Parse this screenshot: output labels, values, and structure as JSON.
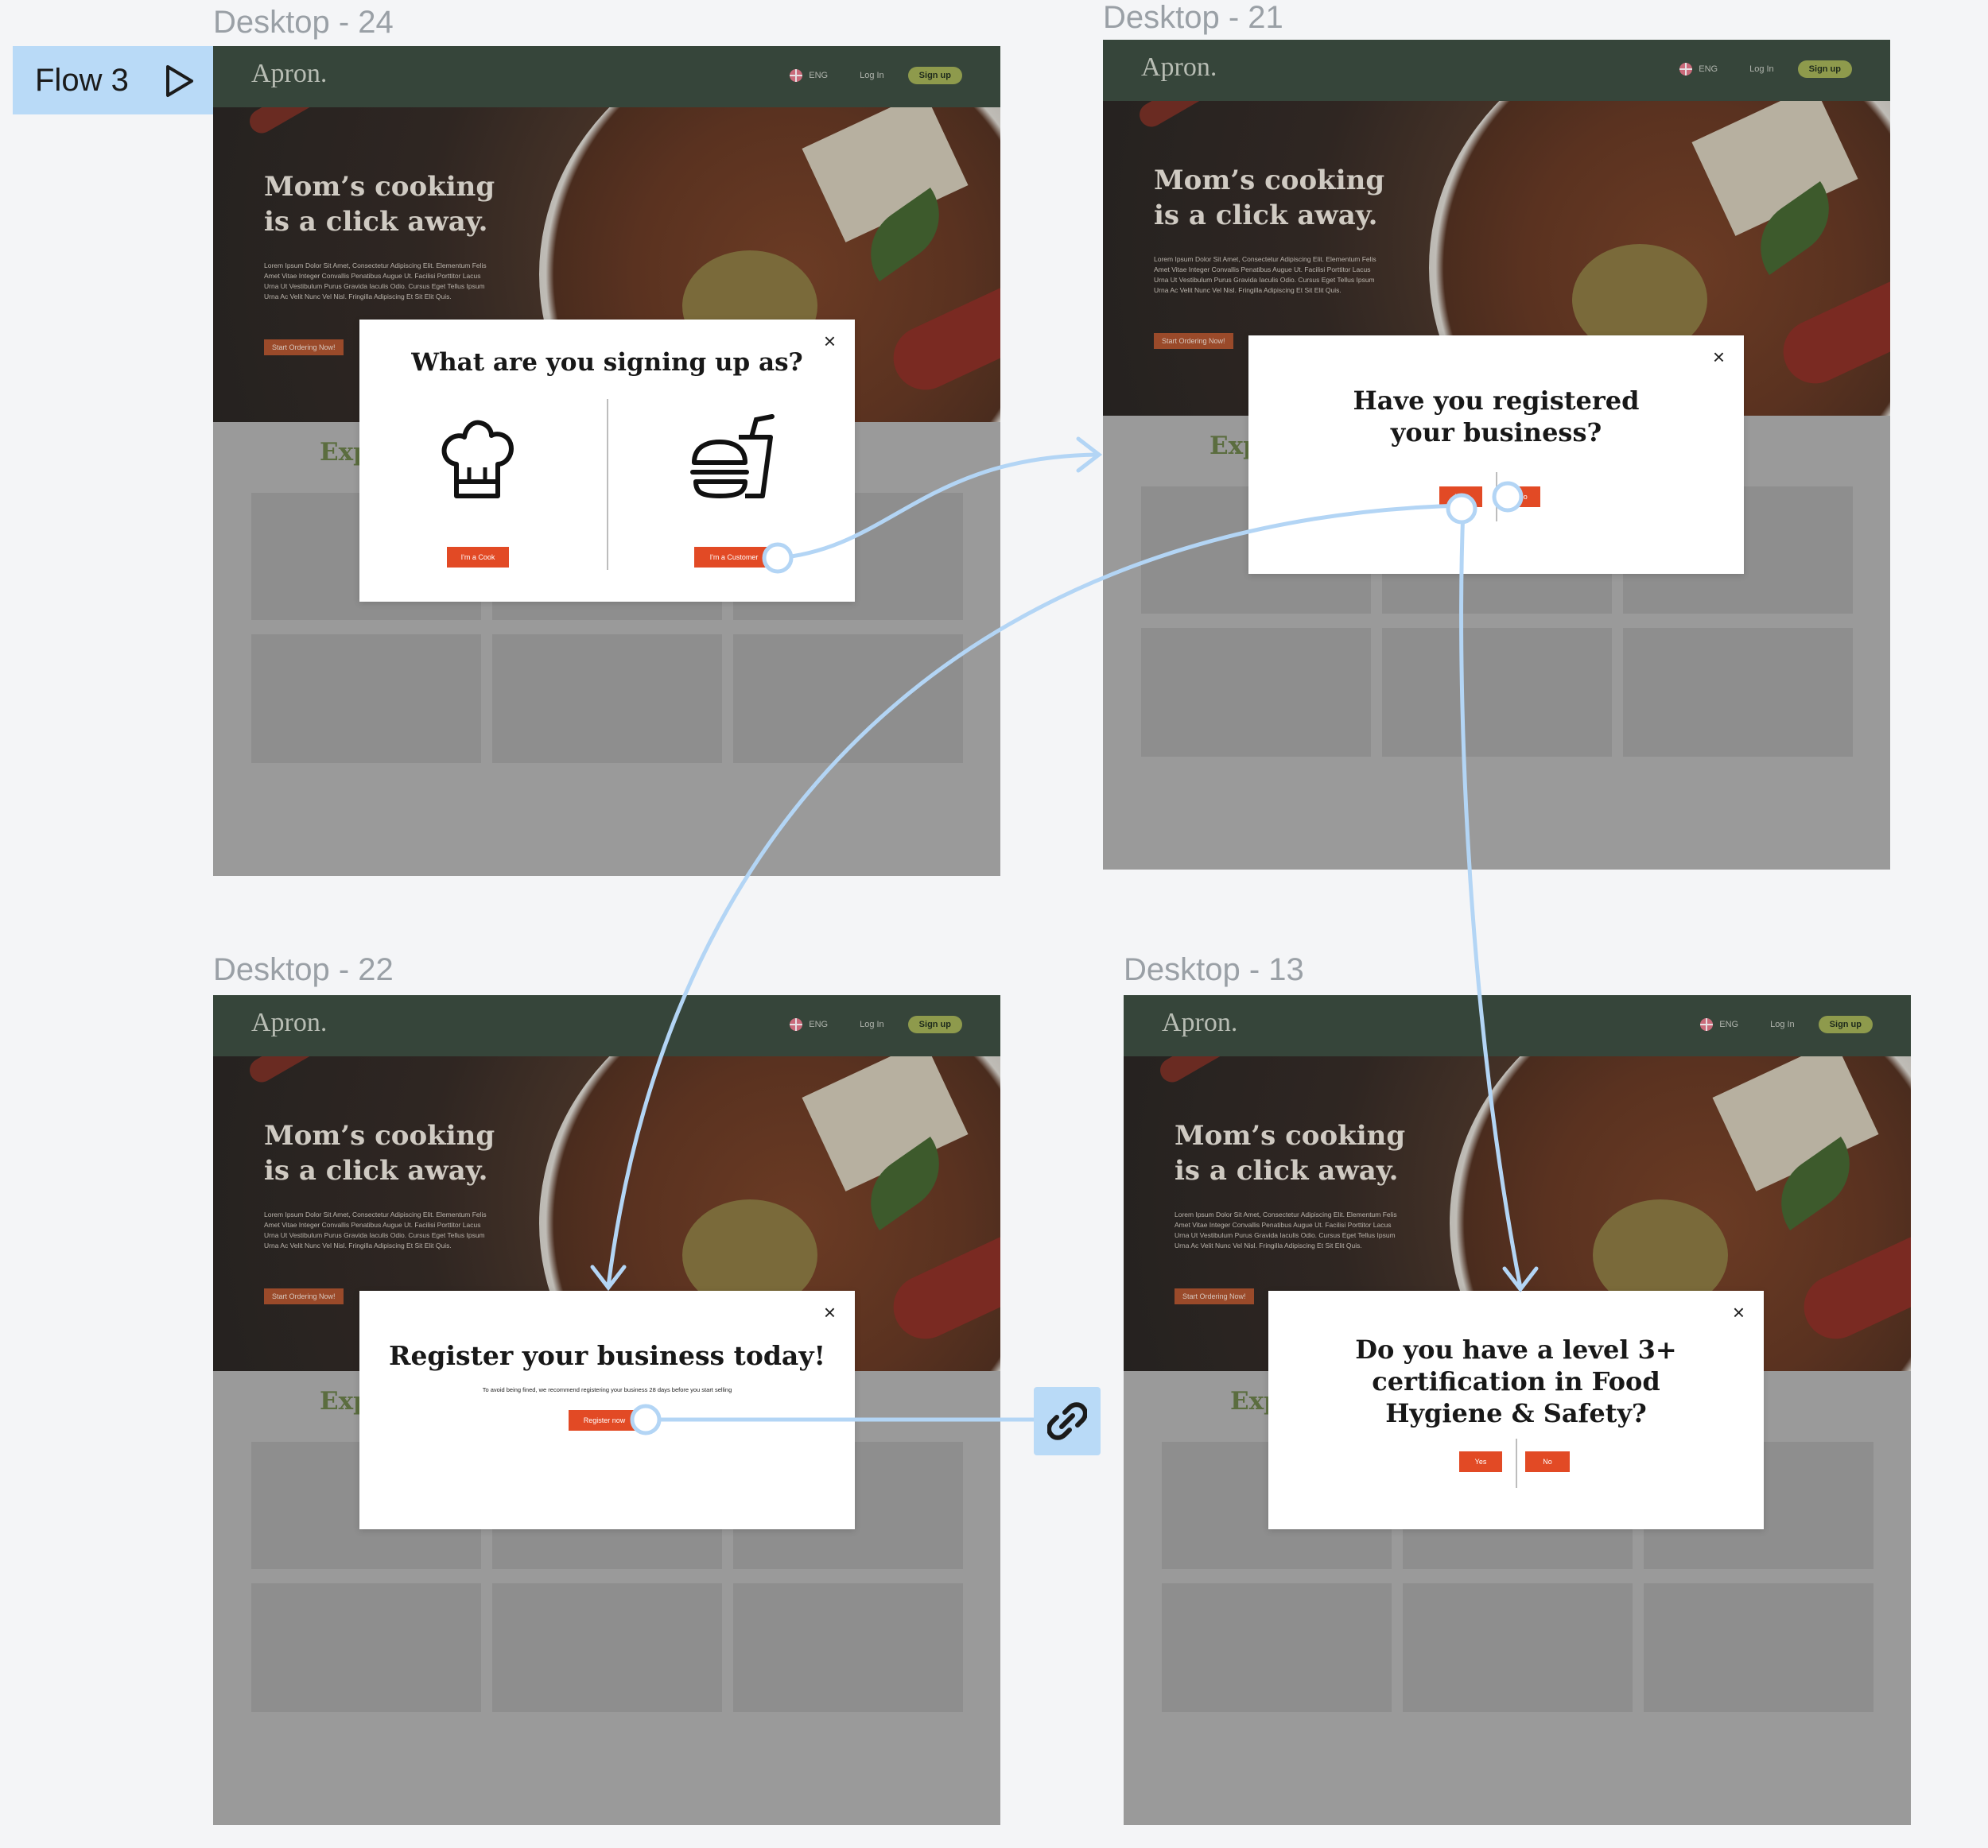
{
  "flow": {
    "label": "Flow 3"
  },
  "frames": [
    {
      "label": "Desktop - 24"
    },
    {
      "label": "Desktop - 21"
    },
    {
      "label": "Desktop - 22"
    },
    {
      "label": "Desktop - 13"
    }
  ],
  "site": {
    "logo": "Apron.",
    "lang": "ENG",
    "login": "Log In",
    "signup": "Sign up",
    "hero_title_line1": "Mom’s cooking",
    "hero_title_line2": "is a click away.",
    "hero_body": "Lorem Ipsum Dolor Sit Amet, Consectetur Adipiscing Elit. Elementum Felis Amet Vitae Integer Convallis Penatibus Augue Ut. Facilisi Porttitor Lacus Urna Ut Vestibulum Purus Gravida Iaculis Odio. Cursus Eget Tellus Ipsum Urna Ac Velit Nunc Vel Nisl. Fringilla Adipiscing Et Sit Elit Quis.",
    "hero_button": "Start Ordering Now!",
    "section_title": "Exp"
  },
  "modals": {
    "signing_up": {
      "title": "What are you signing up as?",
      "cook_button": "I'm a Cook",
      "customer_button": "I'm a Customer",
      "close": "×"
    },
    "registered": {
      "title_line1": "Have you registered",
      "title_line2": "your business?",
      "yes": "Yes",
      "no": "No",
      "close": "×"
    },
    "register": {
      "title": "Register your business today!",
      "note": "To avoid being fined, we recommend registering your business 28 days before you start selling",
      "button": "Register now",
      "close": "×"
    },
    "certification": {
      "title_line1": "Do you have a level 3+",
      "title_line2": "certification in Food",
      "title_line3": "Hygiene & Safety?",
      "yes": "Yes",
      "no": "No",
      "close": "×"
    }
  },
  "colors": {
    "nav": "#36453a",
    "accent": "#e24a25",
    "connector": "#b3d5f5",
    "flow_tag": "#b9daf7"
  },
  "icons": [
    "play-icon",
    "chef-hat-icon",
    "burger-drink-icon",
    "link-icon",
    "flag-icon",
    "close-icon"
  ]
}
